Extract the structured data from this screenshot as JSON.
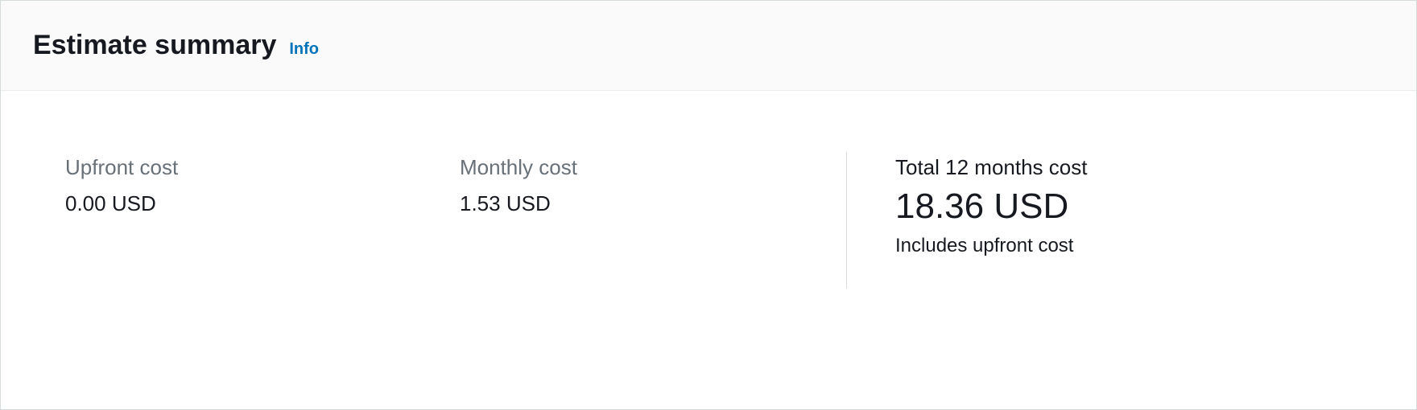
{
  "header": {
    "title": "Estimate summary",
    "info_link": "Info"
  },
  "costs": {
    "upfront": {
      "label": "Upfront cost",
      "value": "0.00 USD"
    },
    "monthly": {
      "label": "Monthly cost",
      "value": "1.53 USD"
    },
    "total": {
      "label": "Total 12 months cost",
      "value": "18.36 USD",
      "note": "Includes upfront cost"
    }
  }
}
